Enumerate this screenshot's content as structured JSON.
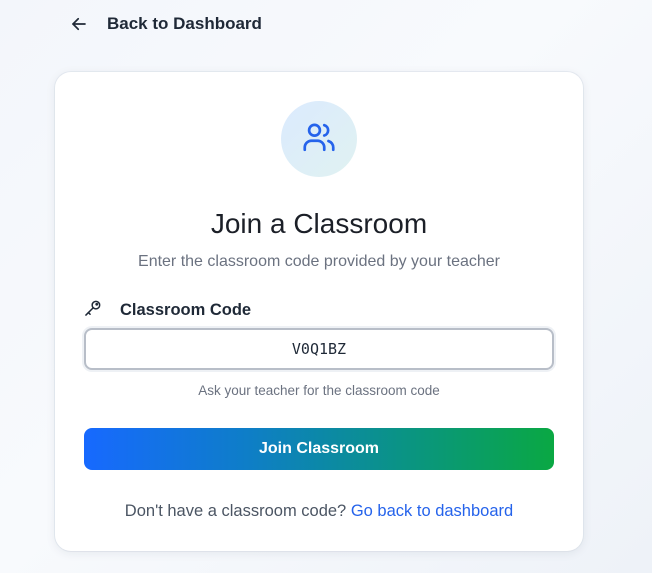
{
  "nav": {
    "back_label": "Back to Dashboard",
    "back_icon": "arrow-left-icon"
  },
  "card": {
    "icon": "users-icon",
    "title": "Join a Classroom",
    "subtitle": "Enter the classroom code provided by your teacher",
    "field_label": "Classroom Code",
    "field_icon": "key-icon",
    "code_value": "V0Q1BZ",
    "helper_text": "Ask your teacher for the classroom code",
    "submit_label": "Join Classroom",
    "footer_text": "Don't have a classroom code? ",
    "footer_link": "Go back to dashboard"
  },
  "colors": {
    "accent_blue": "#2563eb",
    "button_gradient_start": "#1769ff",
    "button_gradient_end": "#0aa843",
    "icon_stroke": "#2563eb"
  }
}
